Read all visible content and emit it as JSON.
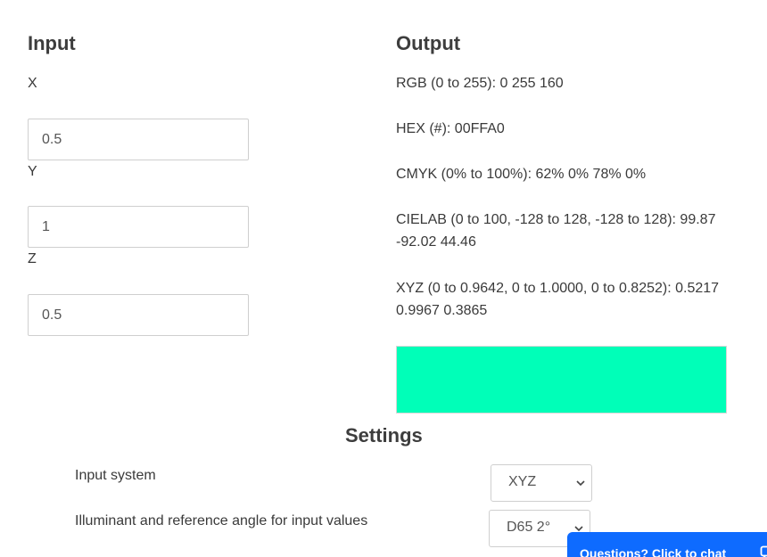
{
  "input": {
    "heading": "Input",
    "fields": [
      {
        "label": "X",
        "value": "0.5"
      },
      {
        "label": "Y",
        "value": "1"
      },
      {
        "label": "Z",
        "value": "0.5"
      }
    ]
  },
  "output": {
    "heading": "Output",
    "rgb": "RGB (0 to 255): 0 255 160",
    "hex": "HEX (#): 00FFA0",
    "cmyk": "CMYK (0% to 100%): 62% 0% 78% 0%",
    "cielab": "CIELAB (0 to 100, -128 to 128, -128 to 128): 99.87 -92.02 44.46",
    "xyz": "XYZ (0 to 0.9642, 0 to 1.0000, 0 to 0.8252): 0.5217 0.9967 0.3865",
    "swatch_color": "#00FFB8"
  },
  "settings": {
    "heading": "Settings",
    "input_system": {
      "label": "Input system",
      "value": "XYZ"
    },
    "illuminant": {
      "label": "Illuminant and reference angle for input values",
      "value": "D65 2°"
    }
  },
  "chat": {
    "label": "Questions? Click to chat",
    "color": "#0E6BFF"
  },
  "icons": {
    "dropdown": "chevron-down-icon",
    "chat": "chat-bubble-icon"
  }
}
